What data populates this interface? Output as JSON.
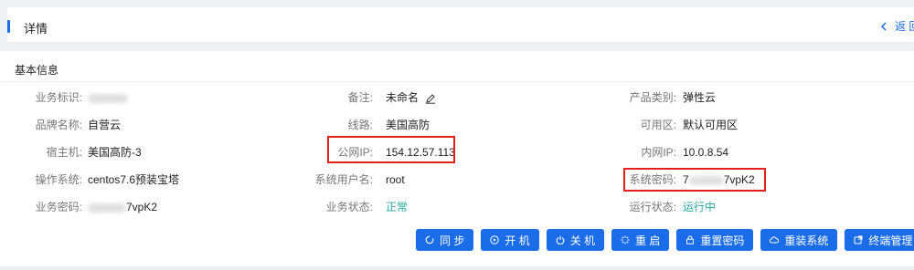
{
  "header": {
    "title": "详情",
    "back_label": "返 回"
  },
  "section_title": "基本信息",
  "fields": {
    "business_id": {
      "label": "业务标识:",
      "value": ""
    },
    "remark": {
      "label": "备注:",
      "value": "未命名"
    },
    "product_type": {
      "label": "产品类别:",
      "value": "弹性云"
    },
    "brand": {
      "label": "品牌名称:",
      "value": "自营云"
    },
    "line": {
      "label": "线路:",
      "value": "美国高防"
    },
    "zone": {
      "label": "可用区:",
      "value": "默认可用区"
    },
    "host": {
      "label": "宿主机:",
      "value": "美国高防-3"
    },
    "public_ip": {
      "label": "公网IP:",
      "value": "154.12.57.113"
    },
    "private_ip": {
      "label": "内网IP:",
      "value": "10.0.8.54"
    },
    "os": {
      "label": "操作系统:",
      "value": "centos7.6预装宝塔"
    },
    "sys_user": {
      "label": "系统用户名:",
      "value": "root"
    },
    "sys_password": {
      "label": "系统密码:",
      "value_prefix": "7",
      "value_suffix": "7vpK2"
    },
    "biz_password": {
      "label": "业务密码:",
      "value_suffix": "7vpK2"
    },
    "biz_status": {
      "label": "业务状态:",
      "value": "正常"
    },
    "run_status": {
      "label": "运行状态:",
      "value": "运行中"
    }
  },
  "buttons": {
    "sync": "同 步",
    "power_on": "开 机",
    "power_off": "关 机",
    "restart": "重 启",
    "reset_password": "重置密码",
    "reinstall": "重装系统",
    "terminal": "终端管理"
  },
  "colors": {
    "accent": "#1a6ce8",
    "status_ok": "#2aa5a0",
    "highlight": "#e0221c"
  }
}
